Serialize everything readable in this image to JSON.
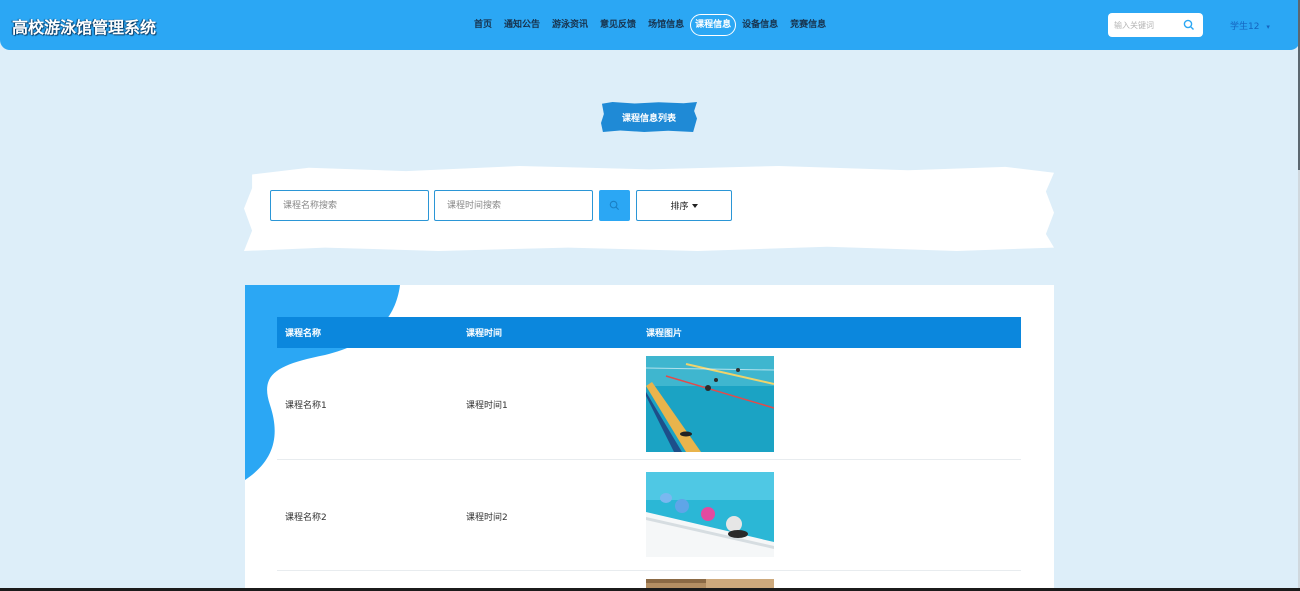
{
  "header": {
    "brand": "高校游泳馆管理系统",
    "nav": [
      {
        "label": "首页"
      },
      {
        "label": "通知公告"
      },
      {
        "label": "游泳资讯"
      },
      {
        "label": "意见反馈"
      },
      {
        "label": "场馆信息"
      },
      {
        "label": "课程信息",
        "active": true
      },
      {
        "label": "设备信息"
      },
      {
        "label": "竞赛信息"
      }
    ],
    "search_placeholder": "输入关键词",
    "user": "学生12",
    "search_icon": "search-icon"
  },
  "page": {
    "title": "课程信息列表"
  },
  "filters": {
    "name_placeholder": "课程名称搜索",
    "time_placeholder": "课程时间搜索",
    "search_icon": "search-icon",
    "sort_label": "排序"
  },
  "table": {
    "columns": [
      "课程名称",
      "课程时间",
      "课程图片"
    ],
    "rows": [
      {
        "name": "课程名称1",
        "time": "课程时间1",
        "image": "pool-lanes-swimmers"
      },
      {
        "name": "课程名称2",
        "time": "课程时间2",
        "image": "pool-edge-swimmers-caps"
      },
      {
        "name": "",
        "time": "",
        "image": "poolside-wall"
      }
    ]
  },
  "colors": {
    "header": "#2ba7f4",
    "page_bg": "#ddeef9",
    "table_header": "#0b87dd",
    "accent": "#1f8ad6"
  }
}
